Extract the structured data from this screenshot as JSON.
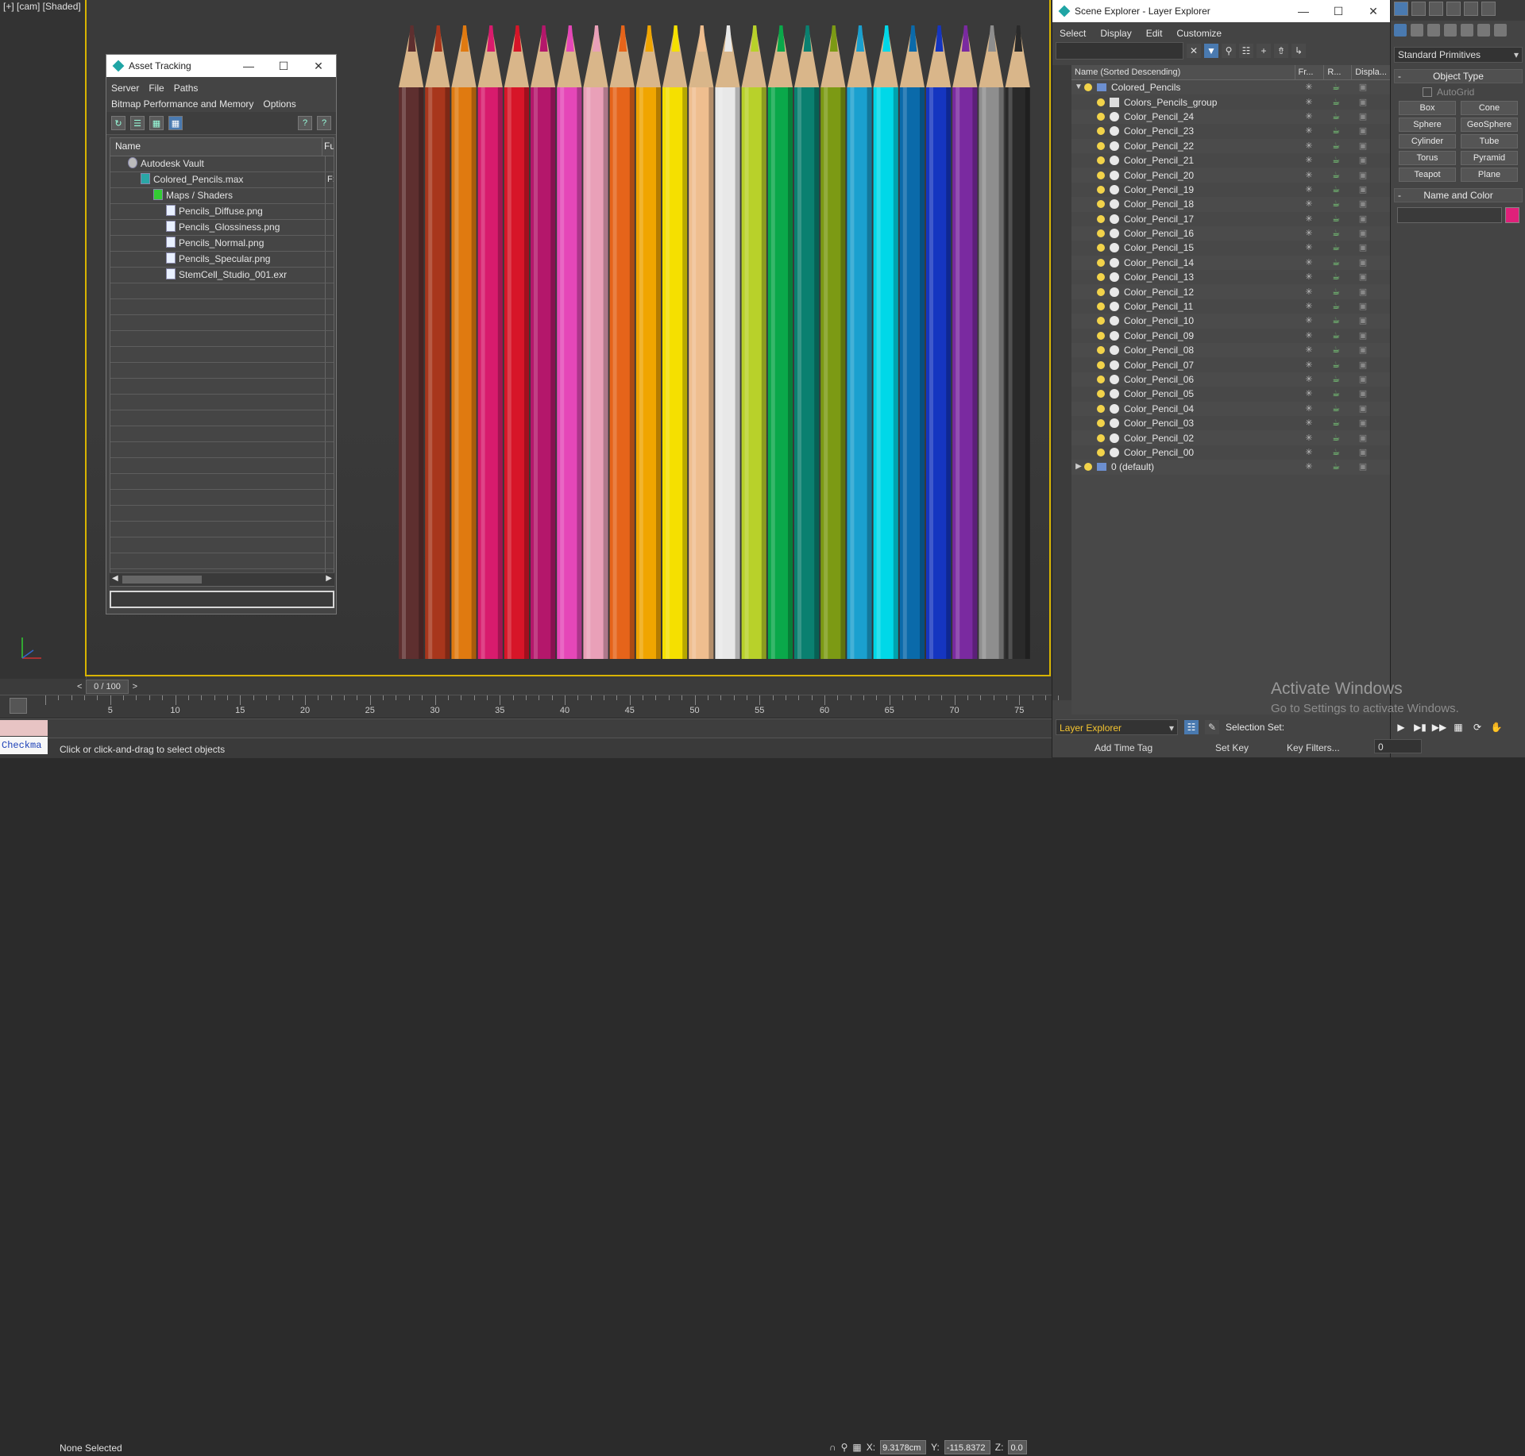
{
  "viewport": {
    "label": "[+] [cam] [Shaded]",
    "pencil_colors": [
      "#5e2f2f",
      "#a8361c",
      "#e07a10",
      "#d81b6d",
      "#d71528",
      "#b4176b",
      "#e547b8",
      "#e9a0b8",
      "#e6641a",
      "#f0a500",
      "#f5e000",
      "#efbe8f",
      "#e8e8e8",
      "#b8d12a",
      "#0aa84a",
      "#0a8070",
      "#7c9a14",
      "#1aa0cf",
      "#00d8e8",
      "#0a6aaa",
      "#1535c0",
      "#7a2aa0",
      "#8e8e8e",
      "#2a2a2a"
    ]
  },
  "system": {
    "activate_title": "Activate Windows",
    "activate_sub": "Go to Settings to activate Windows."
  },
  "asset_tracking": {
    "title": "Asset Tracking",
    "menu": [
      "Server",
      "File",
      "Paths",
      "Bitmap Performance and Memory",
      "Options"
    ],
    "col_name": "Name",
    "col_full": "Fu",
    "rows": [
      {
        "label": "Autodesk Vault",
        "indent": 1,
        "icon": "vault"
      },
      {
        "label": "Colored_Pencils.max",
        "indent": 2,
        "icon": "max",
        "extra": "F:"
      },
      {
        "label": "Maps / Shaders",
        "indent": 3,
        "icon": "maps"
      },
      {
        "label": "Pencils_Diffuse.png",
        "indent": 4,
        "icon": "file"
      },
      {
        "label": "Pencils_Glossiness.png",
        "indent": 4,
        "icon": "file"
      },
      {
        "label": "Pencils_Normal.png",
        "indent": 4,
        "icon": "file"
      },
      {
        "label": "Pencils_Specular.png",
        "indent": 4,
        "icon": "file"
      },
      {
        "label": "StemCell_Studio_001.exr",
        "indent": 4,
        "icon": "file"
      }
    ]
  },
  "scene_explorer": {
    "title": "Scene Explorer - Layer Explorer",
    "menu": [
      "Select",
      "Display",
      "Edit",
      "Customize"
    ],
    "columns": {
      "name": "Name (Sorted Descending)",
      "frozen": "Fr...",
      "render": "R...",
      "display": "Displa..."
    },
    "root": "Colored_Pencils",
    "group": "Colors_Pencils_group",
    "items": [
      "Color_Pencil_24",
      "Color_Pencil_23",
      "Color_Pencil_22",
      "Color_Pencil_21",
      "Color_Pencil_20",
      "Color_Pencil_19",
      "Color_Pencil_18",
      "Color_Pencil_17",
      "Color_Pencil_16",
      "Color_Pencil_15",
      "Color_Pencil_14",
      "Color_Pencil_13",
      "Color_Pencil_12",
      "Color_Pencil_11",
      "Color_Pencil_10",
      "Color_Pencil_09",
      "Color_Pencil_08",
      "Color_Pencil_07",
      "Color_Pencil_06",
      "Color_Pencil_05",
      "Color_Pencil_04",
      "Color_Pencil_03",
      "Color_Pencil_02",
      "Color_Pencil_00"
    ],
    "default_layer": "0 (default)",
    "explorer_dropdown": "Layer Explorer",
    "selection_set": "Selection Set:"
  },
  "command_panel": {
    "primitive_dropdown": "Standard Primitives",
    "object_type": "Object Type",
    "autogrid": "AutoGrid",
    "primitives": [
      "Box",
      "Cone",
      "Sphere",
      "GeoSphere",
      "Cylinder",
      "Tube",
      "Torus",
      "Pyramid",
      "Teapot",
      "Plane"
    ],
    "name_and_color": "Name and Color",
    "swatch_color": "#e0207a"
  },
  "timeline": {
    "slider": "0 / 100",
    "prev": "<",
    "next": ">",
    "ticks": [
      "5",
      "10",
      "15",
      "20",
      "25",
      "30",
      "35",
      "40",
      "45",
      "50",
      "55",
      "60",
      "65",
      "70",
      "75"
    ]
  },
  "status": {
    "selection": "None Selected",
    "prompt": "Click or click-and-drag to select objects",
    "listener": "Checkma",
    "x_label": "X:",
    "x_value": "9.3178cm",
    "y_label": "Y:",
    "y_value": "-115.8372",
    "z_label": "Z:",
    "z_value": "0.0",
    "add_time_tag": "Add Time Tag",
    "set_key": "Set Key",
    "key_filters": "Key Filters...",
    "frame": "0"
  }
}
